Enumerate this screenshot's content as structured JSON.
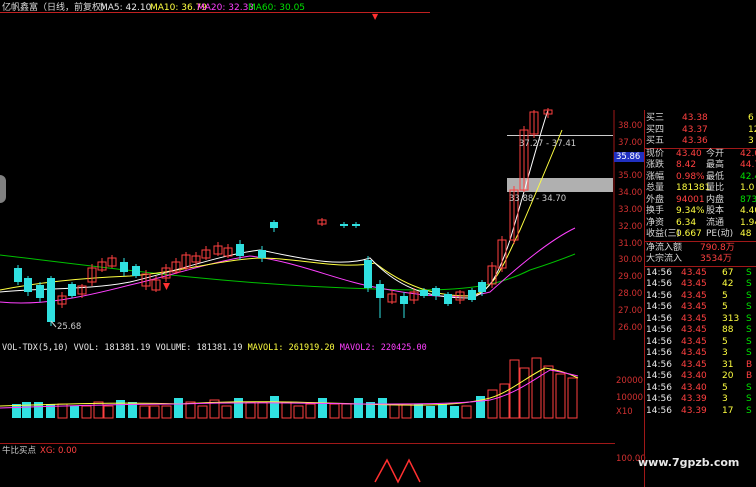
{
  "header": {
    "title": "亿帆鑫富（日线，前复权）",
    "ma5": "MA5: 42.10",
    "ma10": "MA10: 36.79",
    "ma20": "MA20: 32.33",
    "ma60": "MA60: 30.05"
  },
  "main_chart": {
    "low_label": "25.68",
    "range_label_1": "37.27 - 37.41",
    "range_label_2": "33.88 - 34.70",
    "y_ticks": [
      "38.00",
      "37.00",
      "36.00",
      "35.00",
      "34.00",
      "33.00",
      "32.00",
      "31.00",
      "30.00",
      "29.00",
      "28.00",
      "27.00",
      "26.00"
    ],
    "current_price_tag": "35.86"
  },
  "volume_panel": {
    "vvol": "VOL-TDX(5,10) VVOL: 181381.19",
    "volume": "VOLUME: 181381.19",
    "mavol1": "MAVOL1: 261919.20",
    "mavol2": "MAVOL2: 220425.00",
    "y_ticks": [
      "20000",
      "10000"
    ],
    "unit": "X10"
  },
  "indicator_panel": {
    "title": "牛比买点",
    "xg": "XG: 0.00",
    "y_tick": "100.00"
  },
  "order_book": [
    {
      "label": "买三",
      "price": "43.38",
      "vol": "6"
    },
    {
      "label": "买四",
      "price": "43.37",
      "vol": "12"
    },
    {
      "label": "买五",
      "price": "43.36",
      "vol": "3"
    }
  ],
  "quote": [
    {
      "l1": "现价",
      "v1": "43.40",
      "l2": "今开",
      "v2": "42.0"
    },
    {
      "l1": "涨跌",
      "v1": "8.42",
      "l2": "最高",
      "v2": "44.7"
    },
    {
      "l1": "涨幅",
      "v1": "0.98%",
      "l2": "最低",
      "v2": "42.4"
    },
    {
      "l1": "总量",
      "v1": "181381",
      "l2": "量比",
      "v2": "1.0"
    },
    {
      "l1": "外盘",
      "v1": "94001",
      "l2": "内盘",
      "v2": "8738"
    },
    {
      "l1": "换手",
      "v1": "9.34%",
      "l2": "股本",
      "v2": "4.40"
    },
    {
      "l1": "净资",
      "v1": "6.34",
      "l2": "流通",
      "v2": "1.94"
    },
    {
      "l1": "收益(三)",
      "v1": "0.667",
      "l2": "PE(动)",
      "v2": "48"
    }
  ],
  "funds": [
    {
      "label": "净流入额",
      "value": "790.8万"
    },
    {
      "label": "大宗流入",
      "value": "3534万"
    }
  ],
  "ticks": [
    {
      "time": "14:56",
      "price": "43.45",
      "vol": "67",
      "dir": "S"
    },
    {
      "time": "14:56",
      "price": "43.45",
      "vol": "42",
      "dir": "S"
    },
    {
      "time": "14:56",
      "price": "43.45",
      "vol": "5",
      "dir": "S"
    },
    {
      "time": "14:56",
      "price": "43.45",
      "vol": "5",
      "dir": "S"
    },
    {
      "time": "14:56",
      "price": "43.45",
      "vol": "313",
      "dir": "S"
    },
    {
      "time": "14:56",
      "price": "43.45",
      "vol": "88",
      "dir": "S"
    },
    {
      "time": "14:56",
      "price": "43.45",
      "vol": "5",
      "dir": "S"
    },
    {
      "time": "14:56",
      "price": "43.45",
      "vol": "3",
      "dir": "S"
    },
    {
      "time": "14:56",
      "price": "43.45",
      "vol": "31",
      "dir": "B"
    },
    {
      "time": "14:56",
      "price": "43.40",
      "vol": "20",
      "dir": "B"
    },
    {
      "time": "14:56",
      "price": "43.40",
      "vol": "5",
      "dir": "S"
    },
    {
      "time": "14:56",
      "price": "43.39",
      "vol": "3",
      "dir": "S"
    },
    {
      "time": "14:56",
      "price": "43.39",
      "vol": "17",
      "dir": "S"
    }
  ],
  "watermark": "www.7gpzb.com",
  "colors": {
    "up": "#ff4040",
    "down": "#30e0e0",
    "ma5": "#ffffff",
    "ma10": "#ffff40",
    "ma20": "#ff40ff",
    "ma60": "#00c000"
  }
}
